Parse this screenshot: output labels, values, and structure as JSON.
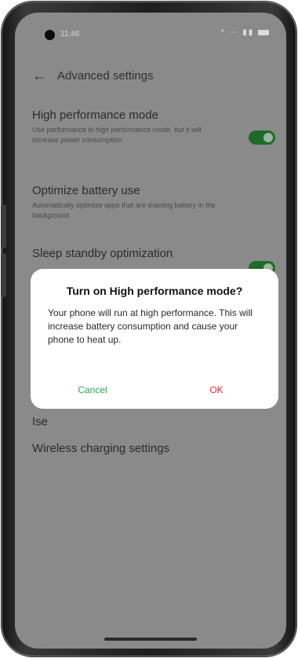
{
  "status_bar": {
    "time": "11:46",
    "icons": "* ⋯ ▮▮"
  },
  "header": {
    "back_icon": "←",
    "title": "Advanced settings"
  },
  "settings": [
    {
      "title": "High performance mode",
      "description": "Use performance in high performance mode, but it will increase power consumption.",
      "toggle_on": true
    },
    {
      "title": "Optimize battery use",
      "description": "Automatically optimize apps that are draining battery in the background."
    },
    {
      "title": "Sleep standby optimization",
      "toggle_on": true
    },
    {
      "title": "Ise"
    },
    {
      "title": "Wireless charging settings"
    }
  ],
  "dialog": {
    "title": "Turn on High performance mode?",
    "message": "Your phone will run at high performance. This will increase battery consumption and cause your phone to heat up.",
    "cancel_label": "Cancel",
    "ok_label": "OK"
  },
  "colors": {
    "toggle_on": "#1f6a2a",
    "cancel": "#2fa44f",
    "ok": "#d9303a",
    "scrim_bg": "#8a8a8a"
  }
}
